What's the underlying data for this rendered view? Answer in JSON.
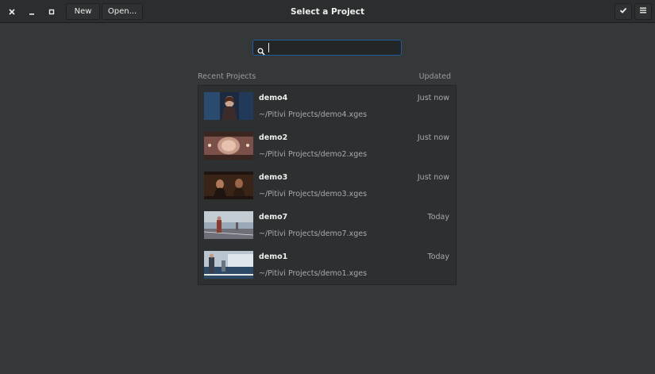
{
  "window": {
    "title": "Select a Project",
    "new_label": "New",
    "open_label": "Open..."
  },
  "search": {
    "value": "",
    "placeholder": ""
  },
  "list_header": {
    "left": "Recent Projects",
    "right": "Updated"
  },
  "projects": [
    {
      "name": "demo4",
      "path": "~/Pitivi Projects/demo4.xges",
      "updated": "Just now"
    },
    {
      "name": "demo2",
      "path": "~/Pitivi Projects/demo2.xges",
      "updated": "Just now"
    },
    {
      "name": "demo3",
      "path": "~/Pitivi Projects/demo3.xges",
      "updated": "Just now"
    },
    {
      "name": "demo7",
      "path": "~/Pitivi Projects/demo7.xges",
      "updated": "Today"
    },
    {
      "name": "demo1",
      "path": "~/Pitivi Projects/demo1.xges",
      "updated": "Today"
    }
  ],
  "icons": {
    "close": "close-icon",
    "minimize": "minimize-icon",
    "maximize": "maximize-icon",
    "confirm": "checkmark-icon",
    "menu": "hamburger-menu-icon",
    "search": "search-icon"
  },
  "colors": {
    "background": "#353839",
    "headerbar": "#2b2e2f",
    "list_bg": "#2d3031",
    "focus_border": "#215d9c",
    "primary_text": "#eeeeec",
    "secondary_text": "#a8aaaa"
  }
}
